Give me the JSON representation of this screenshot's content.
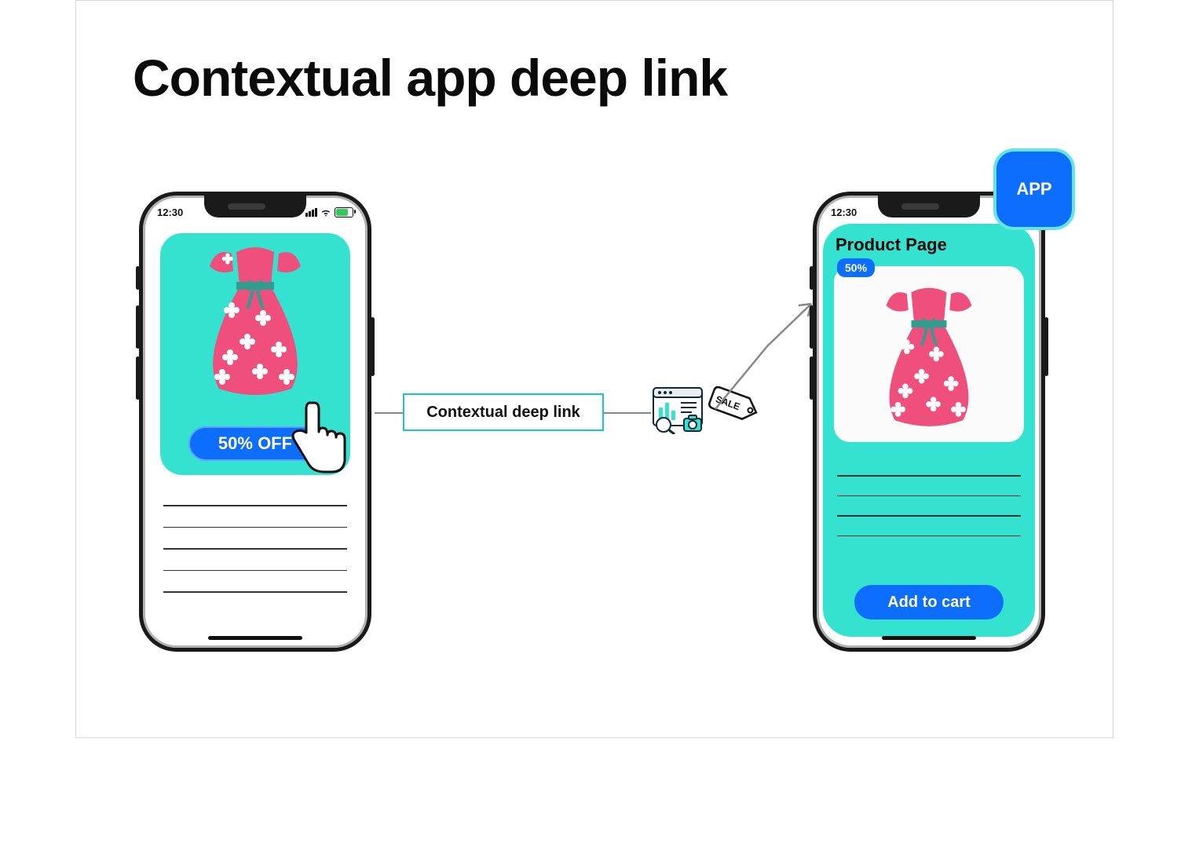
{
  "title": "Contextual app deep link",
  "phone": {
    "time": "12:30"
  },
  "phoneA": {
    "offer_label": "50% OFF"
  },
  "phoneB": {
    "page_title": "Product Page",
    "discount_badge": "50%",
    "cta_label": "Add to cart"
  },
  "middle_label": "Contextual deep link",
  "sale_tag_text": "SALE",
  "app_badge_label": "APP",
  "colors": {
    "accent_blue": "#0d6efd",
    "teal": "#35e1cf",
    "pink": "#ef4f7d"
  }
}
